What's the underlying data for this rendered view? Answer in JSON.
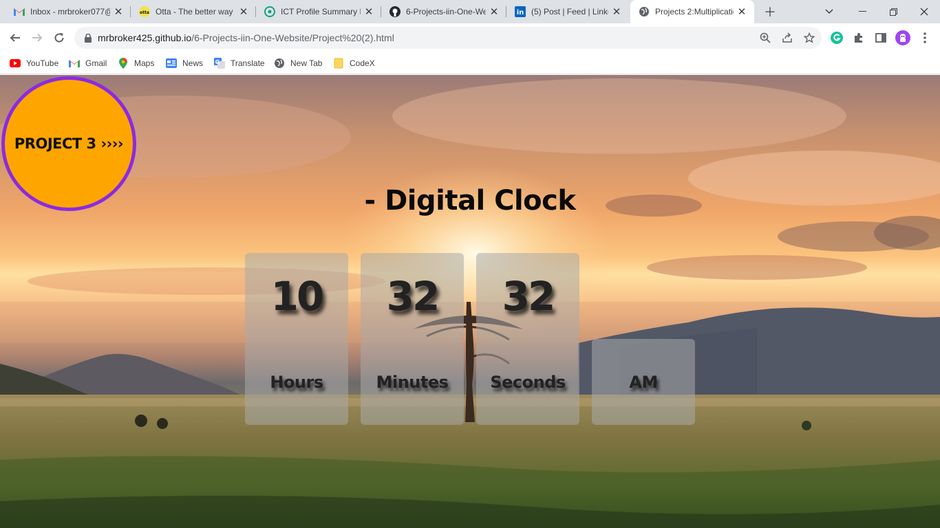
{
  "browser": {
    "tabs": [
      {
        "title": "Inbox - mrbroker077@",
        "icon": "gmail-icon"
      },
      {
        "title": "Otta - The better way",
        "icon": "otta-icon"
      },
      {
        "title": "ICT Profile Summary R",
        "icon": "chatgpt-icon"
      },
      {
        "title": "6-Projects-iin-One-We",
        "icon": "github-icon"
      },
      {
        "title": "(5) Post | Feed | Linked",
        "icon": "linkedin-icon"
      },
      {
        "title": "Projects 2:Multiplicatio",
        "icon": "globe-icon"
      }
    ],
    "url_host": "mrbroker425.github.io",
    "url_path": "/6-Projects-iin-One-Website/Project%20(2).html",
    "bookmarks": [
      {
        "label": "YouTube",
        "icon": "youtube-icon"
      },
      {
        "label": "Gmail",
        "icon": "gmail-icon"
      },
      {
        "label": "Maps",
        "icon": "maps-icon"
      },
      {
        "label": "News",
        "icon": "news-icon"
      },
      {
        "label": "Translate",
        "icon": "translate-icon"
      },
      {
        "label": "New Tab",
        "icon": "globe-icon"
      },
      {
        "label": "CodeX",
        "icon": "folder-icon"
      }
    ]
  },
  "page": {
    "project_link": "PROJECT 3 ››››",
    "title": "- Digital Clock",
    "clock": {
      "hours": "10",
      "minutes": "32",
      "seconds": "32",
      "hours_label": "Hours",
      "minutes_label": "Minutes",
      "seconds_label": "Seconds",
      "period": "AM"
    },
    "colors": {
      "circle_fill": "#ffa500",
      "circle_border": "#8a2be2"
    }
  }
}
